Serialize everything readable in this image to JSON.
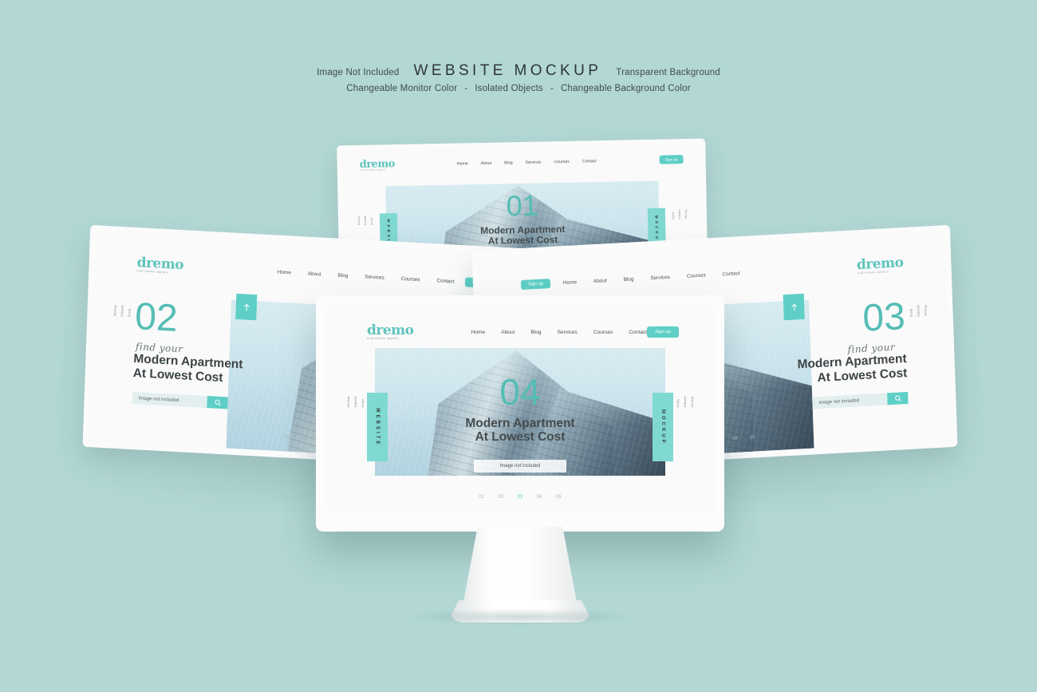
{
  "header": {
    "left_note": "Image Not Included",
    "title": "WEBSITE MOCKUP",
    "right_note": "Transparent Background",
    "sub_items": [
      "Changeable Monitor Color",
      "Isolated Objects",
      "Changeable Background Color"
    ],
    "separator": "-"
  },
  "colors": {
    "background": "#b2d7d4",
    "accent_teal": "#5ecfc6",
    "accent_tab": "#7fd9d0",
    "number_teal": "#54bdb4",
    "text_dark": "#3c4446"
  },
  "site": {
    "logo": "dremo",
    "logo_tagline": "real estate agency",
    "nav_links": [
      "Home",
      "About",
      "Blog",
      "Services",
      "Courses",
      "Contact"
    ],
    "signup_label": "Sign up",
    "hero_title_line1": "Modern Apartment",
    "hero_title_line2": "At Lowest Cost",
    "script_text": "find your",
    "image_placeholder": "Image not included",
    "search_placeholder": "Image not included",
    "search_icon": "search-icon",
    "arrow_icon": "arrow-up-icon",
    "tab_left": "WEBSITE",
    "tab_right": "MOCKUP",
    "micro_side": [
      "Easily",
      "Editable",
      "Mockup"
    ],
    "pagination": [
      "01",
      "02",
      "03",
      "04",
      "05"
    ],
    "pagination_active": "03"
  },
  "screens": {
    "top": {
      "number": "01",
      "name": "screen-01"
    },
    "left": {
      "number": "02",
      "name": "screen-02"
    },
    "right": {
      "number": "03",
      "name": "screen-03"
    },
    "front": {
      "number": "04",
      "name": "screen-04"
    }
  }
}
